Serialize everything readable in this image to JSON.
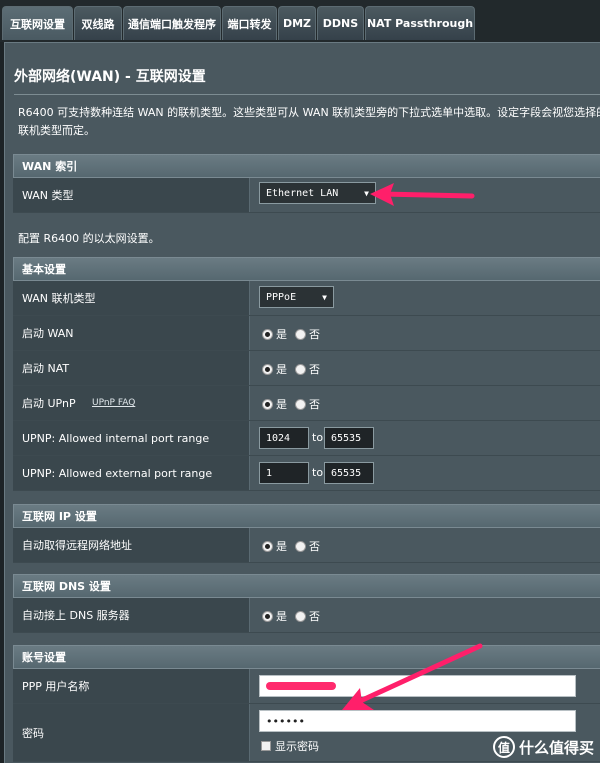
{
  "tabs": [
    {
      "label": "互联网设置"
    },
    {
      "label": "双线路"
    },
    {
      "label": "通信端口触发程序"
    },
    {
      "label": "端口转发"
    },
    {
      "label": "DMZ"
    },
    {
      "label": "DDNS"
    },
    {
      "label": "NAT Passthrough"
    }
  ],
  "page_title": "外部网络(WAN) - 互联网设置",
  "description": "R6400 可支持数种连结 WAN 的联机类型。这些类型可从 WAN 联机类型旁的下拉式选单中选取。设定字段会视您选择的联机类型而定。",
  "wan_index": {
    "header": "WAN 索引",
    "type_label": "WAN 类型",
    "type_value": "Ethernet LAN"
  },
  "ethernet_note": "配置 R6400 的以太网设置。",
  "basic": {
    "header": "基本设置",
    "conn_type_label": "WAN 联机类型",
    "conn_type_value": "PPPoE",
    "enable_wan_label": "启动 WAN",
    "enable_nat_label": "启动 NAT",
    "enable_upnp_label": "启动 UPnP",
    "upnp_faq": "UPnP  FAQ",
    "upnp_internal_label": "UPNP: Allowed internal port range",
    "upnp_internal_from": "1024",
    "upnp_internal_to": "65535",
    "upnp_external_label": "UPNP: Allowed external port range",
    "upnp_external_from": "1",
    "upnp_external_to": "65535",
    "to_label": "to"
  },
  "radio": {
    "yes": "是",
    "no": "否"
  },
  "ip_settings": {
    "header": "互联网 IP 设置",
    "auto_ip_label": "自动取得远程网络地址"
  },
  "dns_settings": {
    "header": "互联网 DNS 设置",
    "auto_dns_label": "自动接上 DNS 服务器"
  },
  "account": {
    "header": "账号设置",
    "username_label": "PPP 用户名称",
    "password_label": "密码",
    "password_value": "••••••",
    "show_password_label": "显示密码"
  },
  "watermark": {
    "badge": "值",
    "text": "什么值得买"
  },
  "colors": {
    "accent_arrow": "#ff1f6a",
    "panel_bg": "#4a585f",
    "label_bg": "#3a474d"
  }
}
